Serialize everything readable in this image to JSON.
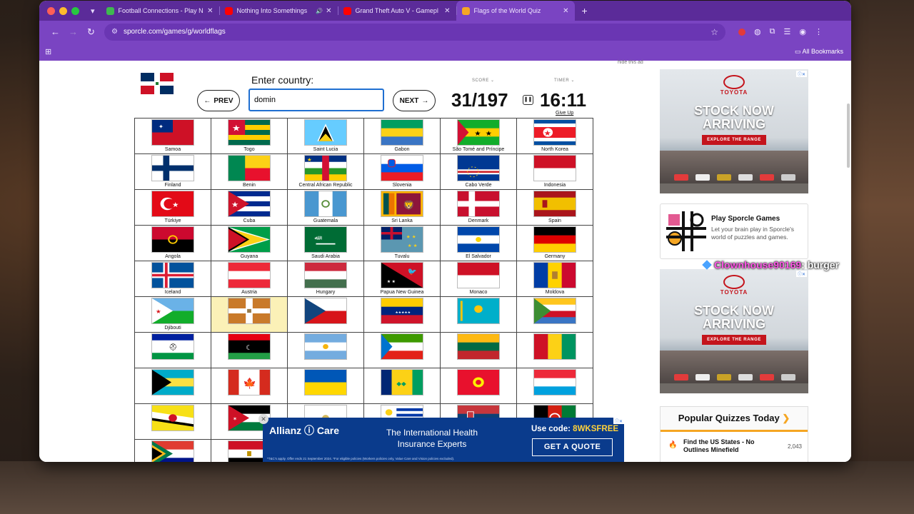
{
  "browser": {
    "tabs": [
      {
        "title": "Football Connections - Play N",
        "favicon_color": "#3fb950"
      },
      {
        "title": "Nothing Into Somethings",
        "favicon_color": "#ff0000"
      },
      {
        "title": "Grand Theft Auto V - Gamepl",
        "favicon_color": "#ff0000"
      },
      {
        "title": "Flags of the World Quiz",
        "favicon_color": "#f5a623",
        "active": true
      }
    ],
    "url": "sporcle.com/games/g/worldflags",
    "bookmarks_label": "All Bookmarks"
  },
  "quiz": {
    "enter_label": "Enter country:",
    "input_value": "domin",
    "prev_label": "PREV",
    "next_label": "NEXT",
    "score_label": "SCORE",
    "timer_label": "TIMER",
    "score": "31/197",
    "timer": "16:11",
    "give_up": "Give Up",
    "hide_ad": "hide this ad",
    "grid": [
      [
        {
          "name": "Samoa",
          "flag": "samoa"
        },
        {
          "name": "Togo",
          "flag": "togo"
        },
        {
          "name": "Saint Lucia",
          "flag": "stlucia"
        },
        {
          "name": "Gabon",
          "flag": "gabon"
        },
        {
          "name": "São Tomé and Príncipe",
          "flag": "saotome"
        },
        {
          "name": "North Korea",
          "flag": "nkorea"
        }
      ],
      [
        {
          "name": "Finland",
          "flag": "finland"
        },
        {
          "name": "Benin",
          "flag": "benin"
        },
        {
          "name": "Central African Republic",
          "flag": "car"
        },
        {
          "name": "Slovenia",
          "flag": "slovenia"
        },
        {
          "name": "Cabo Verde",
          "flag": "caboverde"
        },
        {
          "name": "Indonesia",
          "flag": "indonesia"
        }
      ],
      [
        {
          "name": "Türkiye",
          "flag": "turkiye"
        },
        {
          "name": "Cuba",
          "flag": "cuba"
        },
        {
          "name": "Guatemala",
          "flag": "guatemala"
        },
        {
          "name": "Sri Lanka",
          "flag": "srilanka"
        },
        {
          "name": "Denmark",
          "flag": "denmark"
        },
        {
          "name": "Spain",
          "flag": "spain"
        }
      ],
      [
        {
          "name": "Angola",
          "flag": "angola"
        },
        {
          "name": "Guyana",
          "flag": "guyana"
        },
        {
          "name": "Saudi Arabia",
          "flag": "saudi"
        },
        {
          "name": "Tuvalu",
          "flag": "tuvalu"
        },
        {
          "name": "El Salvador",
          "flag": "elsalvador"
        },
        {
          "name": "Germany",
          "flag": "germany"
        }
      ],
      [
        {
          "name": "Iceland",
          "flag": "iceland"
        },
        {
          "name": "Austria",
          "flag": "austria"
        },
        {
          "name": "Hungary",
          "flag": "hungary"
        },
        {
          "name": "Papua New Guinea",
          "flag": "png"
        },
        {
          "name": "Monaco",
          "flag": "monaco"
        },
        {
          "name": "Moldova",
          "flag": "moldova"
        }
      ],
      [
        {
          "name": "Djibouti",
          "flag": "djibouti"
        },
        {
          "name": "",
          "flag": "unknown1",
          "highlight": true
        },
        {
          "name": "",
          "flag": "czech"
        },
        {
          "name": "",
          "flag": "venezuela"
        },
        {
          "name": "",
          "flag": "kazakhstan"
        },
        {
          "name": "",
          "flag": "comoros"
        }
      ],
      [
        {
          "name": "",
          "flag": "lesotho"
        },
        {
          "name": "",
          "flag": "libya"
        },
        {
          "name": "",
          "flag": "argentina"
        },
        {
          "name": "",
          "flag": "eqguinea"
        },
        {
          "name": "",
          "flag": "lithuania"
        },
        {
          "name": "",
          "flag": "guinea"
        }
      ],
      [
        {
          "name": "",
          "flag": "bahamas"
        },
        {
          "name": "",
          "flag": "canada"
        },
        {
          "name": "",
          "flag": "ukraine"
        },
        {
          "name": "",
          "flag": "stvincent"
        },
        {
          "name": "",
          "flag": "kyrgyzstan"
        },
        {
          "name": "",
          "flag": "luxembourg"
        }
      ],
      [
        {
          "name": "",
          "flag": "brunei"
        },
        {
          "name": "",
          "flag": "jordan"
        },
        {
          "name": "",
          "flag": "sanmarino"
        },
        {
          "name": "",
          "flag": "uruguay"
        },
        {
          "name": "",
          "flag": "serbia"
        },
        {
          "name": "",
          "flag": "afghanistan"
        }
      ],
      [
        {
          "name": "",
          "flag": "southafrica"
        },
        {
          "name": "",
          "flag": "egypt"
        },
        {
          "name": "",
          "flag": "blank"
        },
        {
          "name": "",
          "flag": "blank"
        },
        {
          "name": "",
          "flag": "blank"
        },
        {
          "name": "",
          "flag": "blank"
        }
      ]
    ]
  },
  "ads": {
    "toyota_brand": "TOYOTA",
    "toyota_headline_1": "STOCK NOW",
    "toyota_headline_2": "ARRIVING",
    "toyota_cta": "EXPLORE THE RANGE",
    "promo_title": "Play Sporcle Games",
    "promo_desc": "Let your brain play in Sporcle's world of puzzles and games.",
    "popular_title": "Popular Quizzes Today",
    "popular_item": "Find the US States - No Outlines Minefield",
    "popular_count": "2,043",
    "allianz_logo": "Allianz ⓘ Care",
    "allianz_text": "The International Health Insurance Experts",
    "allianz_code_label": "Use code:",
    "allianz_code": "8WKSFREE",
    "allianz_cta": "GET A QUOTE",
    "allianz_fine": "*T&C's apply. Offer ends 21 September 2024. *For eligible policies (Workers policies only, Value Care and Vision policies excluded)."
  },
  "overlay": {
    "username": "Clownhouse90169",
    "message": ": burger"
  },
  "colors": {
    "browser_purple": "#7a44c2",
    "tabbar_purple": "#5b2b99",
    "accent_orange": "#f5a623"
  }
}
